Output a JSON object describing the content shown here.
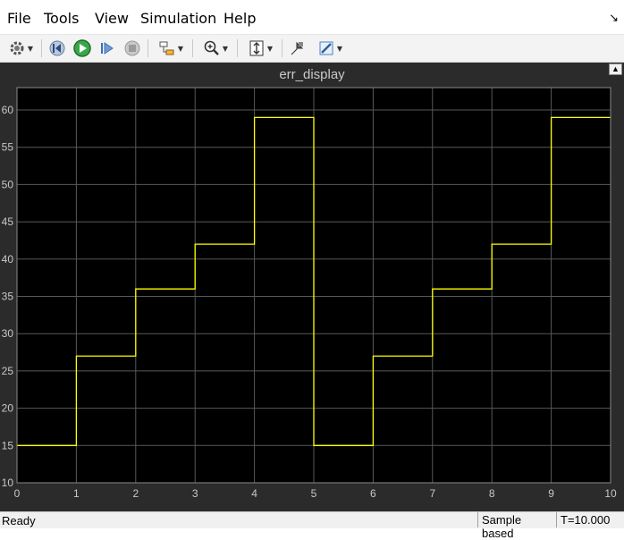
{
  "menu": [
    "File",
    "Tools",
    "View",
    "Simulation",
    "Help"
  ],
  "toolbar": {
    "icons": [
      "gear-icon",
      "rewind-icon",
      "run-icon",
      "step-forward-icon",
      "stop-icon",
      "highlight-block-icon",
      "zoom-in-icon",
      "fit-axes-icon",
      "write-access-icon",
      "style-icon"
    ]
  },
  "figure": {
    "title": "err_display"
  },
  "status": {
    "ready": "Ready",
    "mode": "Sample based",
    "time": "T=10.000"
  },
  "colors": {
    "plot_bg": "#000000",
    "figure_bg": "#2b2b2b",
    "grid": "#595959",
    "signal": "#ffff00",
    "tick_text": "#c8c8c8"
  },
  "chart_data": {
    "type": "line",
    "title": "err_display",
    "xlabel": "",
    "ylabel": "",
    "xlim": [
      0,
      10
    ],
    "ylim": [
      10,
      63
    ],
    "xticks": [
      0,
      1,
      2,
      3,
      4,
      5,
      6,
      7,
      8,
      9,
      10
    ],
    "yticks": [
      10,
      15,
      20,
      25,
      30,
      35,
      40,
      45,
      50,
      55,
      60
    ],
    "grid": true,
    "series": [
      {
        "step": true,
        "x": [
          0,
          1,
          2,
          3,
          4,
          5,
          6,
          7,
          8,
          9,
          10
        ],
        "y": [
          15,
          27,
          36,
          42,
          59,
          15,
          27,
          36,
          42,
          59,
          59
        ]
      }
    ]
  }
}
